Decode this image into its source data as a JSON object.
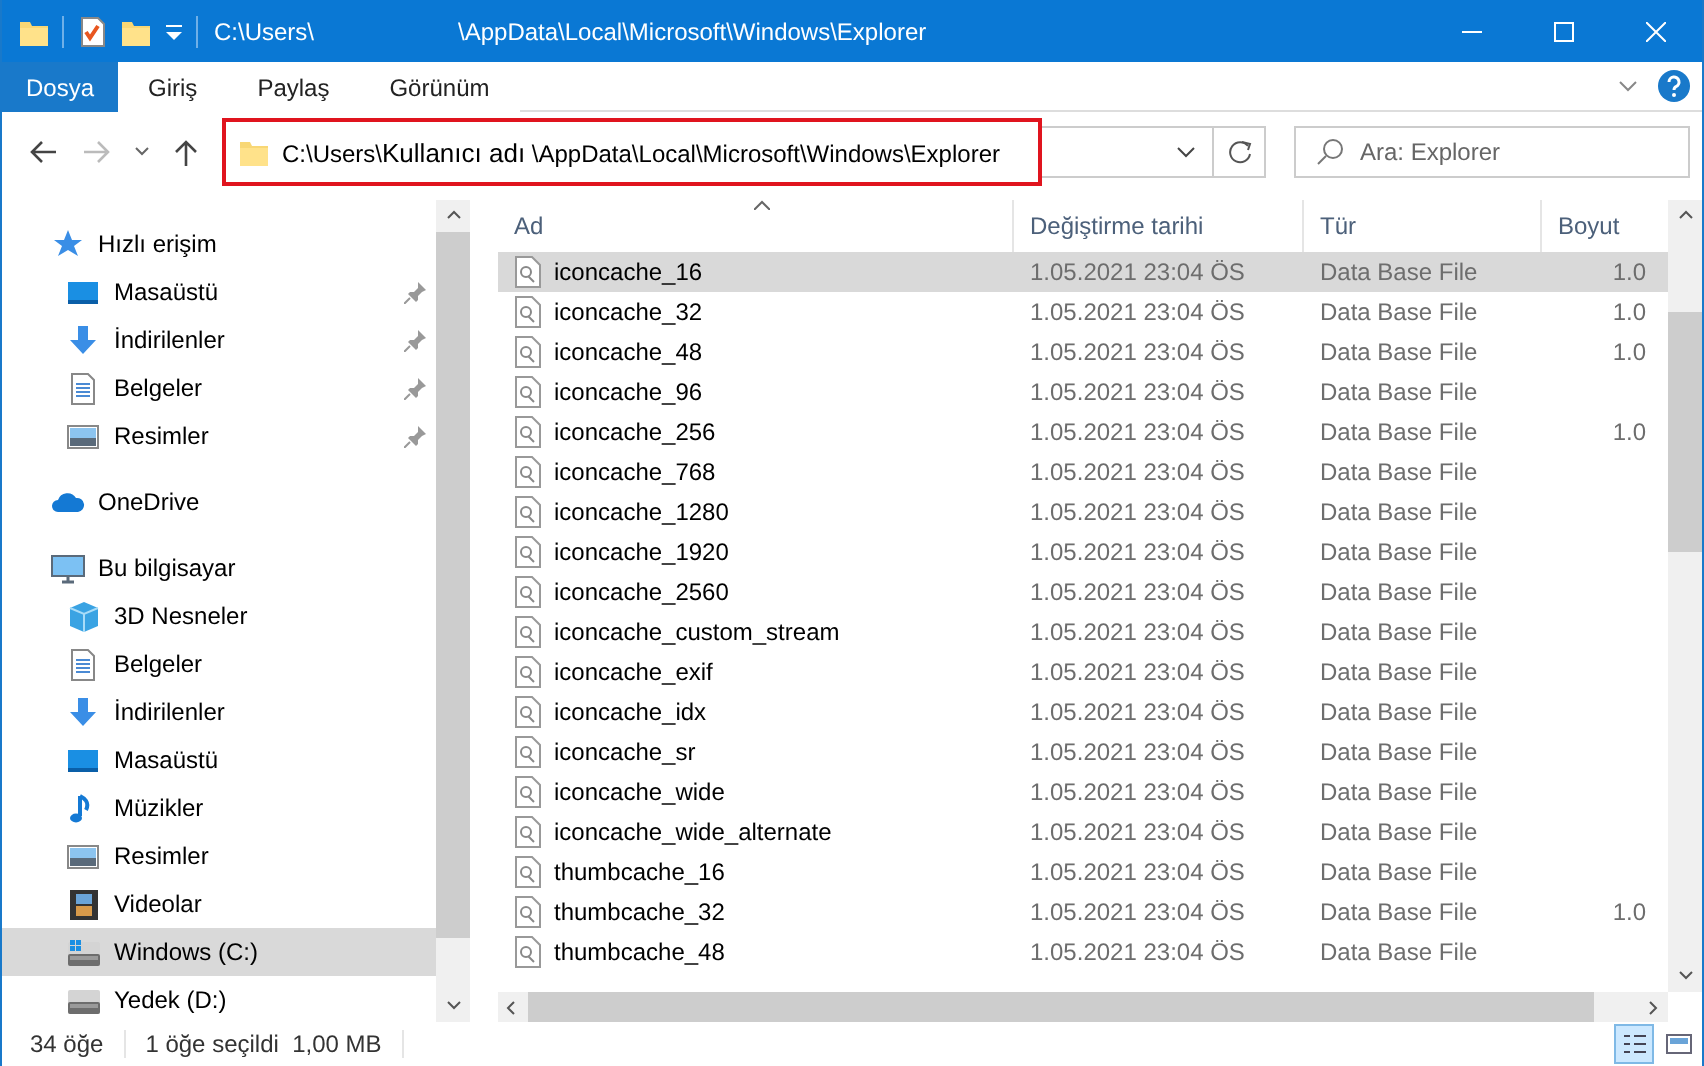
{
  "window": {
    "title_parts": [
      "C:\\Users\\",
      "\\AppData\\Local\\Microsoft\\Windows\\Explorer"
    ]
  },
  "ribbon_tabs": [
    {
      "label": "Dosya",
      "selected": true
    },
    {
      "label": "Giriş",
      "selected": false
    },
    {
      "label": "Paylaş",
      "selected": false
    },
    {
      "label": "Görünüm",
      "selected": false
    }
  ],
  "address": {
    "prefix": "C:\\Users\\",
    "user": "Kullanıcı adı",
    "suffix": "\\AppData\\Local\\Microsoft\\Windows\\Explorer",
    "highlighted": true
  },
  "search": {
    "placeholder": "Ara: Explorer"
  },
  "sidebar": {
    "items": [
      {
        "label": "Hızlı erişim",
        "kind": "star",
        "pinned": false,
        "selected": false,
        "children": [
          {
            "label": "Masaüstü",
            "kind": "desktop",
            "pinned": true,
            "selected": false
          },
          {
            "label": "İndirilenler",
            "kind": "download",
            "pinned": true,
            "selected": false
          },
          {
            "label": "Belgeler",
            "kind": "document",
            "pinned": true,
            "selected": false
          },
          {
            "label": "Resimler",
            "kind": "pictures",
            "pinned": true,
            "selected": false
          }
        ]
      },
      {
        "label": "OneDrive",
        "kind": "cloud",
        "pinned": false,
        "selected": false
      },
      {
        "label": "Bu bilgisayar",
        "kind": "computer",
        "pinned": false,
        "selected": false,
        "children": [
          {
            "label": "3D Nesneler",
            "kind": "cube",
            "pinned": false,
            "selected": false
          },
          {
            "label": "Belgeler",
            "kind": "document",
            "pinned": false,
            "selected": false
          },
          {
            "label": "İndirilenler",
            "kind": "download",
            "pinned": false,
            "selected": false
          },
          {
            "label": "Masaüstü",
            "kind": "desktop",
            "pinned": false,
            "selected": false
          },
          {
            "label": "Müzikler",
            "kind": "music",
            "pinned": false,
            "selected": false
          },
          {
            "label": "Resimler",
            "kind": "pictures",
            "pinned": false,
            "selected": false
          },
          {
            "label": "Videolar",
            "kind": "video",
            "pinned": false,
            "selected": false
          },
          {
            "label": "Windows (C:)",
            "kind": "drive",
            "pinned": false,
            "selected": true
          },
          {
            "label": "Yedek (D:)",
            "kind": "drive",
            "pinned": false,
            "selected": false
          }
        ]
      }
    ]
  },
  "table": {
    "columns": [
      "Ad",
      "Değiştirme tarihi",
      "Tür",
      "Boyut"
    ],
    "rows": [
      {
        "name": "iconcache_16",
        "date": "1.05.2021 23:04 ÖS",
        "type": "Data Base File",
        "size": "1.0",
        "selected": true
      },
      {
        "name": "iconcache_32",
        "date": "1.05.2021 23:04 ÖS",
        "type": "Data Base File",
        "size": "1.0",
        "selected": false
      },
      {
        "name": "iconcache_48",
        "date": "1.05.2021 23:04 ÖS",
        "type": "Data Base File",
        "size": "1.0",
        "selected": false
      },
      {
        "name": "iconcache_96",
        "date": "1.05.2021 23:04 ÖS",
        "type": "Data Base File",
        "selected": false
      },
      {
        "name": "iconcache_256",
        "date": "1.05.2021 23:04 ÖS",
        "type": "Data Base File",
        "size": "1.0",
        "selected": false
      },
      {
        "name": "iconcache_768",
        "date": "1.05.2021 23:04 ÖS",
        "type": "Data Base File",
        "selected": false
      },
      {
        "name": "iconcache_1280",
        "date": "1.05.2021 23:04 ÖS",
        "type": "Data Base File",
        "selected": false
      },
      {
        "name": "iconcache_1920",
        "date": "1.05.2021 23:04 ÖS",
        "type": "Data Base File",
        "selected": false
      },
      {
        "name": "iconcache_2560",
        "date": "1.05.2021 23:04 ÖS",
        "type": "Data Base File",
        "selected": false
      },
      {
        "name": "iconcache_custom_stream",
        "date": "1.05.2021 23:04 ÖS",
        "type": "Data Base File",
        "selected": false
      },
      {
        "name": "iconcache_exif",
        "date": "1.05.2021 23:04 ÖS",
        "type": "Data Base File",
        "selected": false
      },
      {
        "name": "iconcache_idx",
        "date": "1.05.2021 23:04 ÖS",
        "type": "Data Base File",
        "selected": false
      },
      {
        "name": "iconcache_sr",
        "date": "1.05.2021 23:04 ÖS",
        "type": "Data Base File",
        "selected": false
      },
      {
        "name": "iconcache_wide",
        "date": "1.05.2021 23:04 ÖS",
        "type": "Data Base File",
        "selected": false
      },
      {
        "name": "iconcache_wide_alternate",
        "date": "1.05.2021 23:04 ÖS",
        "type": "Data Base File",
        "selected": false
      },
      {
        "name": "thumbcache_16",
        "date": "1.05.2021 23:04 ÖS",
        "type": "Data Base File",
        "selected": false
      },
      {
        "name": "thumbcache_32",
        "date": "1.05.2021 23:04 ÖS",
        "type": "Data Base File",
        "size": "1.0",
        "selected": false
      },
      {
        "name": "thumbcache_48",
        "date": "1.05.2021 23:04 ÖS",
        "type": "Data Base File",
        "selected": false
      }
    ]
  },
  "status_bar": {
    "count": "34 öğe",
    "selection": "1 öğe seçildi  1,00 MB"
  },
  "view_buttons": [
    {
      "kind": "details",
      "selected": true
    },
    {
      "kind": "tiles",
      "selected": false
    }
  ]
}
